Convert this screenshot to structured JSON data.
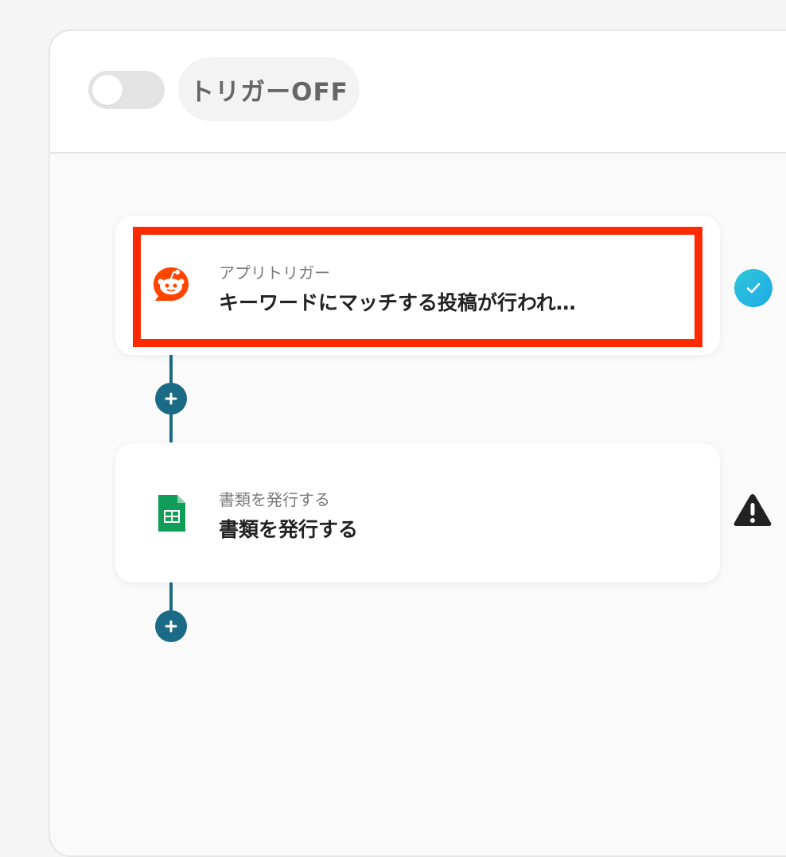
{
  "header": {
    "trigger_status_label": "トリガーOFF",
    "toggle_state": "off"
  },
  "steps": [
    {
      "subtitle": "アプリトリガー",
      "title": "キーワードにマッチする投稿が行われ…",
      "icon": "reddit-icon",
      "status": "complete",
      "status_icon": "check-icon",
      "highlighted": true,
      "highlight_color": "#ff2a00"
    },
    {
      "subtitle": "書類を発行する",
      "title": "書類を発行する",
      "icon": "google-sheets-icon",
      "status": "warning",
      "status_icon": "warning-icon"
    }
  ],
  "colors": {
    "connector": "#1b6b87",
    "reddit": "#ff4500",
    "sheets": "#0f9d58",
    "check": "#2ec8d8"
  }
}
